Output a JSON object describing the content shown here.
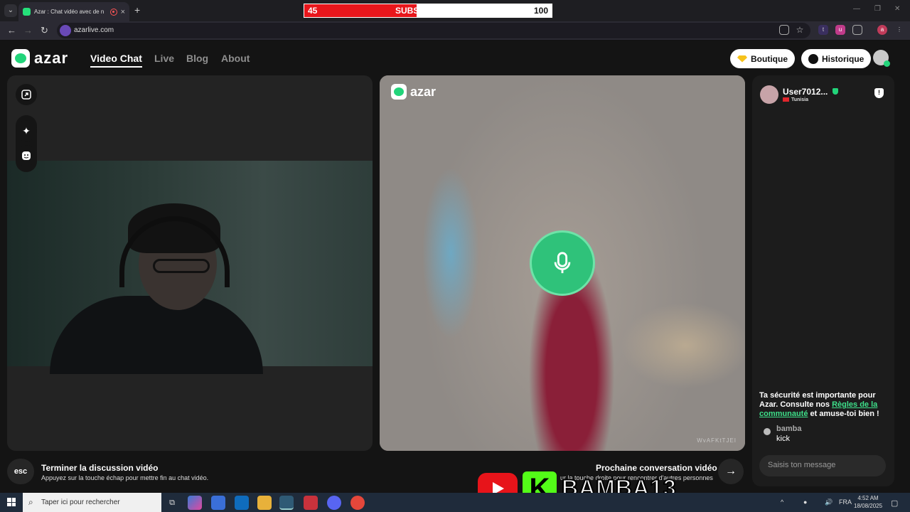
{
  "browser": {
    "tab_title": "Azar : Chat vidéo avec de n",
    "tab_close": "×",
    "new_tab": "+",
    "url": "azarlive.com"
  },
  "subscriber_bar": {
    "current": "45",
    "label": "SUBSCRIBERS",
    "goal": "100",
    "progress": 0.45
  },
  "site": {
    "logo": "azar",
    "nav": [
      {
        "label": "Video Chat"
      },
      {
        "label": "Live"
      },
      {
        "label": "Blog"
      },
      {
        "label": "About"
      }
    ],
    "boutique_label": "Boutique",
    "historique_label": "Historique"
  },
  "remote": {
    "logo": "azar",
    "watermark": "WvAFKtTJEI"
  },
  "chat": {
    "partner_name": "User7012...",
    "partner_country": "Tunisia",
    "safety_text_1": "Ta sécurité est importante pour Azar. Consulte nos ",
    "safety_link": "Règles de la communauté",
    "safety_text_2": " et amuse-toi bien !",
    "messages": [
      {
        "user": "bamba",
        "text": "kick"
      }
    ],
    "input_placeholder": "Saisis ton message"
  },
  "bottom": {
    "esc_label": "esc",
    "end_title": "Terminer la discussion vidéo",
    "end_sub": "Appuyez sur la touche échap pour mettre fin au chat vidéo.",
    "next_title": "Prochaine conversation vidéo",
    "next_sub": "ur la touche droite pour rencontrer d'autres personnes",
    "next_arrow": "→"
  },
  "overlay": {
    "brand_name": "BAMBA13",
    "kick_letter": "K"
  },
  "taskbar": {
    "search_placeholder": "Taper ici pour rechercher",
    "lang": "FRA",
    "time": "4:52 AM",
    "date": "18/08/2025"
  },
  "colors": {
    "accent_green": "#22d47a",
    "subscriber_red": "#e8161b",
    "kick_green": "#53fc18",
    "youtube_red": "#e7141a"
  }
}
